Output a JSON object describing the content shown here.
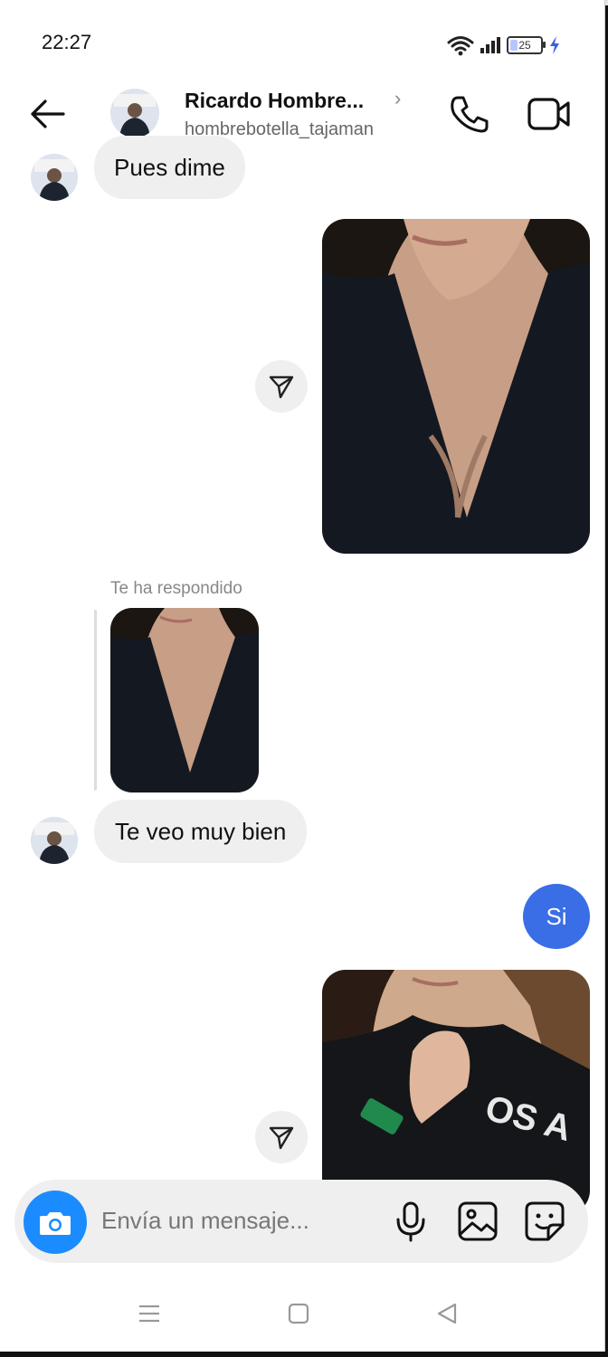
{
  "status_bar": {
    "time": "22:27",
    "battery": "25"
  },
  "header": {
    "name": "Ricardo Hombre...",
    "username": "hombrebotella_tajaman"
  },
  "messages": {
    "m1_text": "Pues dime",
    "reply_label": "Te ha respondido",
    "m2_text": "Te veo muy bien",
    "m3_text": "Si"
  },
  "composer": {
    "placeholder": "Envía un mensaje..."
  },
  "colors": {
    "accent": "#3a6ee6",
    "camera": "#1a8cff",
    "bubble_in": "#efefef"
  }
}
